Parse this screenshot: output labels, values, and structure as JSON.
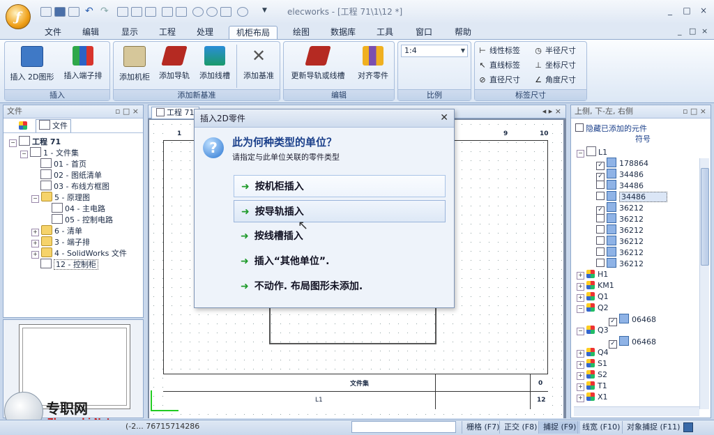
{
  "window": {
    "title": "elecworks - [工程 71\\1\\12 *]",
    "controls": [
      "_",
      "□",
      "×"
    ],
    "mdi_controls": [
      "_",
      "□",
      "×"
    ]
  },
  "menu": {
    "items": [
      "文件",
      "编辑",
      "显示",
      "工程",
      "处理",
      "机柜布局",
      "绘图",
      "数据库",
      "工具",
      "窗口",
      "帮助"
    ],
    "active": "机柜布局"
  },
  "ribbon": {
    "groups": [
      {
        "label": "插入",
        "buttons": [
          "插入 2D图形",
          "插入端子排"
        ]
      },
      {
        "label": "添加新基准",
        "buttons": [
          "添加机柜",
          "添加导轨",
          "添加线槽",
          "添加基准"
        ]
      },
      {
        "label": "编辑",
        "buttons": [
          "更新导轨或线槽",
          "对齐零件"
        ]
      },
      {
        "label": "比例",
        "scale_value": "1:4"
      },
      {
        "label": "标签尺寸",
        "small_buttons": [
          "线性标签",
          "半径尺寸",
          "直线标签",
          "坐标尺寸",
          "直径尺寸",
          "角度尺寸"
        ]
      }
    ]
  },
  "left_panel": {
    "title": "文件",
    "tab": "文件",
    "tree": [
      {
        "level": 0,
        "pm": "−",
        "label": "工程 71",
        "icon": "project-icon"
      },
      {
        "level": 1,
        "pm": "−",
        "label": "1 - 文件集",
        "icon": "book-icon"
      },
      {
        "level": 2,
        "label": "01 - 首页",
        "icon": "page-icon"
      },
      {
        "level": 2,
        "label": "02 - 图纸清单",
        "icon": "list-icon"
      },
      {
        "level": 2,
        "label": "03 - 布线方框图",
        "icon": "schematic-icon"
      },
      {
        "level": 2,
        "pm": "−",
        "label": "5 - 原理图",
        "icon": "folder-icon"
      },
      {
        "level": 3,
        "label": "04 - 主电路",
        "icon": "schematic-icon"
      },
      {
        "level": 3,
        "label": "05 - 控制电路",
        "icon": "schematic-icon"
      },
      {
        "level": 2,
        "pm": "+",
        "label": "6 - 清单",
        "icon": "folder-icon"
      },
      {
        "level": 2,
        "pm": "+",
        "label": "3 - 端子排",
        "icon": "folder-icon"
      },
      {
        "level": 2,
        "pm": "+",
        "label": "4 - SolidWorks 文件",
        "icon": "folder-icon"
      },
      {
        "level": 2,
        "label": "12 - 控制柜",
        "icon": "cabinet-icon",
        "selected": true
      }
    ]
  },
  "document": {
    "tab": "工程 71",
    "ruler_numbers": [
      "1",
      "9",
      "10"
    ],
    "titleblock_text": "文件集",
    "titleblock_fields": [
      "L1",
      "0",
      "12"
    ]
  },
  "dialog": {
    "title": "插入2D零件",
    "heading": "此为何种类型的单位？",
    "subheading": "请指定与此单位关联的零件类型",
    "options": [
      "按机柜插入",
      "按导轨插入",
      "按线槽插入",
      "插入“其他单位”.",
      "不动作. 布局图形未添加."
    ]
  },
  "right_panel": {
    "title": "上侧, 下-左, 右侧",
    "hide_label": "隐藏已添加的元件",
    "column_header": "符号",
    "root": "L1",
    "items": [
      {
        "label": "178864",
        "checked": true
      },
      {
        "label": "34486",
        "checked": true
      },
      {
        "label": "34486",
        "checked": false
      },
      {
        "label": "34486",
        "checked": false,
        "highlight": true
      },
      {
        "label": "36212",
        "checked": true
      },
      {
        "label": "36212",
        "checked": false
      },
      {
        "label": "36212",
        "checked": false
      },
      {
        "label": "36212",
        "checked": false
      },
      {
        "label": "36212",
        "checked": false
      },
      {
        "label": "36212",
        "checked": false
      }
    ],
    "groups": [
      {
        "label": "H1",
        "expanded": false
      },
      {
        "label": "KM1",
        "expanded": false
      },
      {
        "label": "Q1",
        "expanded": false
      },
      {
        "label": "Q2",
        "expanded": true,
        "child": "06468"
      },
      {
        "label": "Q3",
        "expanded": true,
        "child": "06468"
      },
      {
        "label": "Q4",
        "expanded": false
      },
      {
        "label": "S1",
        "expanded": false
      },
      {
        "label": "S2",
        "expanded": false
      },
      {
        "label": "T1",
        "expanded": false
      },
      {
        "label": "X1",
        "expanded": false
      }
    ]
  },
  "status": {
    "coords": "(-2... 76715714286",
    "toggles": [
      "栅格 (F7)",
      "正交 (F8)",
      "捕捉 (F9)",
      "线宽 (F10)",
      "对象捕捉 (F11)"
    ]
  },
  "watermark": {
    "site": "专职网",
    "url": "Zhuanzhi.Net"
  },
  "colors": {
    "accent": "#1e9a2a",
    "ribbon_border": "#8ea8cc",
    "orb": "#f0a018"
  }
}
